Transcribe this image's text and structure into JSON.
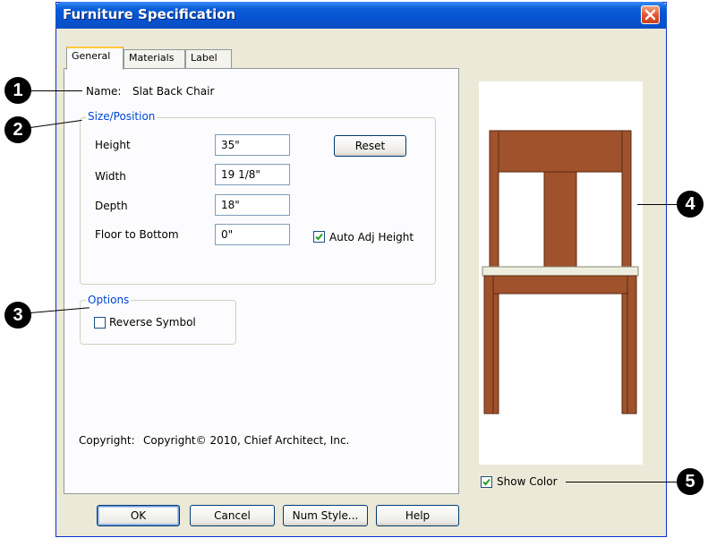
{
  "window": {
    "title": "Furniture Specification"
  },
  "tabs": [
    {
      "label": "General"
    },
    {
      "label": "Materials"
    },
    {
      "label": "Label"
    }
  ],
  "general": {
    "name_label": "Name:",
    "name_value": "Slat Back Chair",
    "size_group_title": "Size/Position",
    "height_label": "Height",
    "height_value": "35\"",
    "width_label": "Width",
    "width_value": "19 1/8\"",
    "depth_label": "Depth",
    "depth_value": "18\"",
    "floor_label": "Floor to Bottom",
    "floor_value": "0\"",
    "reset_label": "Reset",
    "auto_adj_label": "Auto Adj Height",
    "auto_adj_checked": true,
    "options_group_title": "Options",
    "reverse_label": "Reverse Symbol",
    "reverse_checked": false,
    "copyright_label": "Copyright:",
    "copyright_value": "Copyright© 2010, Chief Architect, Inc."
  },
  "preview": {
    "show_color_label": "Show Color",
    "show_color_checked": true,
    "chair_color": "#a0522d",
    "seat_color": "#eeeee0"
  },
  "buttons": {
    "ok": "OK",
    "cancel": "Cancel",
    "num_style": "Num Style...",
    "help": "Help"
  },
  "callouts": [
    "1",
    "2",
    "3",
    "4",
    "5"
  ],
  "colors": {
    "titlebar": "#0653d0",
    "group_title": "#0046d5",
    "dialog_bg": "#ece9d8"
  }
}
